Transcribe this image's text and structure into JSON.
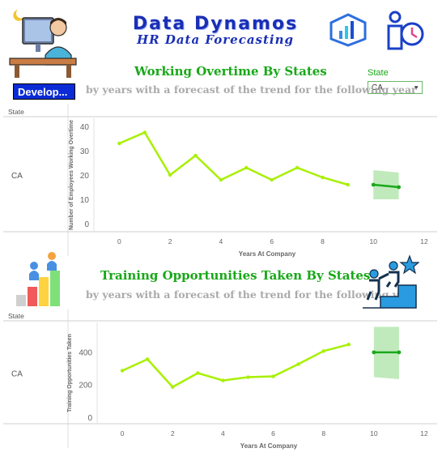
{
  "header": {
    "title": "Data Dynamos",
    "subtitle": "HR Data Forecasting",
    "developer_button": "Develop..."
  },
  "filter": {
    "label": "State",
    "value": "CA"
  },
  "colors": {
    "title_blue": "#1a2fb5",
    "section_green": "#18a818",
    "series_line": "#a8f000",
    "forecast_line": "#1aa81a",
    "forecast_band": "#b6e6b0",
    "button_blue": "#0b2bd6"
  },
  "icons": [
    "developer-at-desk-icon",
    "data-dynamos-logo-icon",
    "employee-time-icon",
    "bar-chart-people-icon",
    "climbing-stairs-icon"
  ],
  "chart_data": [
    {
      "type": "line",
      "title": "Working Overtime By States",
      "subtitle": "by years with a forecast of the trend for the following year",
      "row_header": "State",
      "row_label": "CA",
      "xlabel": "Years At Company",
      "ylabel": "Number of Employees Working Overtime",
      "xlim": [
        -1,
        12
      ],
      "ylim": [
        -2,
        42
      ],
      "x_ticks": [
        0,
        2,
        4,
        6,
        8,
        10,
        12
      ],
      "y_ticks": [
        0,
        10,
        20,
        30,
        40
      ],
      "grid": false,
      "series": [
        {
          "x": [
            0,
            1,
            2,
            3,
            4,
            5,
            6,
            7,
            8,
            9
          ],
          "values": [
            33,
            37.5,
            20,
            28,
            18,
            23,
            18,
            23,
            19,
            16
          ]
        }
      ],
      "forecast": {
        "x": [
          10,
          11
        ],
        "values": [
          16,
          15
        ],
        "upper": [
          22,
          21
        ],
        "lower": [
          10,
          10
        ]
      }
    },
    {
      "type": "line",
      "title": "Training Opportunities Taken By States",
      "subtitle": "by years with a forecast of the trend for the following year",
      "row_header": "State",
      "row_label": "CA",
      "xlabel": "Years At Company",
      "ylabel": "Training Opportunities Taken",
      "xlim": [
        -1,
        12
      ],
      "ylim": [
        -20,
        560
      ],
      "x_ticks": [
        0,
        2,
        4,
        6,
        8,
        10,
        12
      ],
      "y_ticks": [
        0,
        200,
        400
      ],
      "grid": false,
      "series": [
        {
          "x": [
            0,
            1,
            2,
            3,
            4,
            5,
            6,
            7,
            8,
            9
          ],
          "values": [
            285,
            355,
            185,
            270,
            225,
            245,
            250,
            325,
            405,
            445
          ]
        }
      ],
      "forecast": {
        "x": [
          10,
          11
        ],
        "values": [
          397,
          397
        ],
        "upper": [
          553,
          553
        ],
        "lower": [
          245,
          233
        ]
      }
    }
  ]
}
